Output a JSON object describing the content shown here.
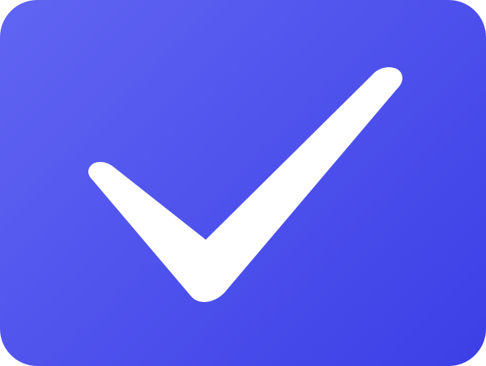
{
  "icon": {
    "name": "checkmark-icon",
    "background_color_start": "#6165f2",
    "background_color_end": "#3c3fe6",
    "check_color": "#ffffff"
  }
}
